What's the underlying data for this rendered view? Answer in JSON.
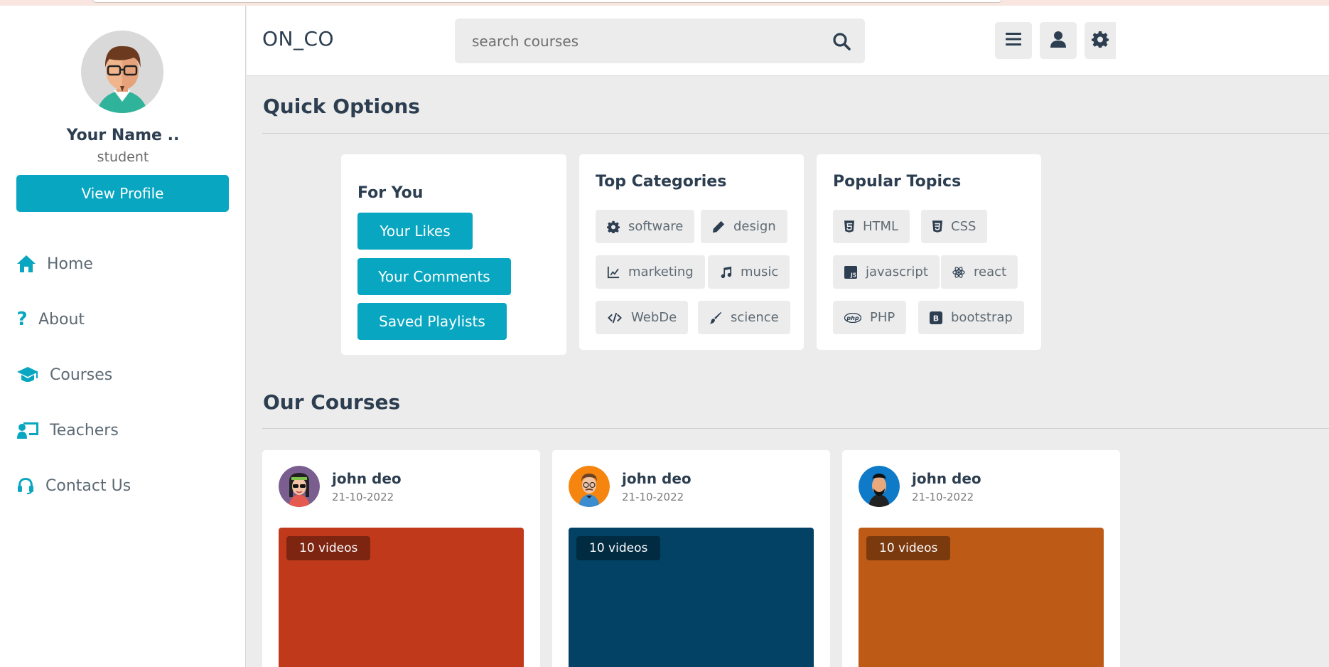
{
  "app": {
    "logo": "ON_CO"
  },
  "search": {
    "placeholder": "search courses"
  },
  "profile": {
    "name": "Your Name ..",
    "role": "student",
    "view_profile_label": "View Profile"
  },
  "nav": {
    "items": [
      {
        "label": "Home",
        "icon": "home-icon"
      },
      {
        "label": "About",
        "icon": "question-icon"
      },
      {
        "label": "Courses",
        "icon": "graduation-cap-icon"
      },
      {
        "label": "Teachers",
        "icon": "chalkboard-teacher-icon"
      },
      {
        "label": "Contact Us",
        "icon": "headset-icon"
      }
    ]
  },
  "header_buttons": [
    "menu-icon",
    "user-icon",
    "gear-icon"
  ],
  "quick_options": {
    "title": "Quick Options",
    "for_you": {
      "title": "For You",
      "buttons": [
        "Your Likes",
        "Your Comments",
        "Saved Playlists"
      ]
    },
    "top_categories": {
      "title": "Top Categories",
      "tags": [
        "software",
        "design",
        "marketing",
        "music",
        "WebDe",
        "science"
      ]
    },
    "popular_topics": {
      "title": "Popular Topics",
      "tags": [
        "HTML",
        "CSS",
        "javascript",
        "react",
        "PHP",
        "bootstrap"
      ]
    }
  },
  "courses": {
    "title": "Our Courses",
    "items": [
      {
        "author": "john deo",
        "date": "21-10-2022",
        "videos": "10 videos",
        "thumb_color": "#c0391b"
      },
      {
        "author": "john deo",
        "date": "21-10-2022",
        "videos": "10 videos",
        "thumb_color": "#034264"
      },
      {
        "author": "john deo",
        "date": "21-10-2022",
        "videos": "10 videos",
        "thumb_color": "#bd5a16"
      }
    ]
  },
  "colors": {
    "accent": "#08a6c0",
    "text": "#2c3e50",
    "background": "#ececec"
  }
}
